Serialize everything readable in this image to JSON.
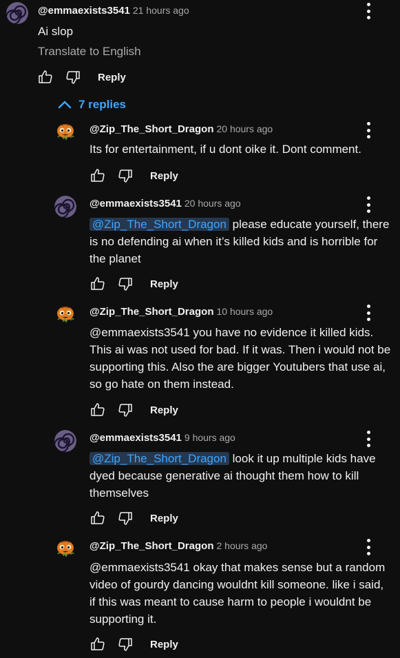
{
  "top_comment": {
    "handle": "@emmaexists3541",
    "time": "21 hours ago",
    "text": "Ai slop",
    "translate_label": "Translate to English",
    "reply_label": "Reply",
    "avatar_icon": "spiral-avatar-icon"
  },
  "replies_toggle": {
    "label": "7 replies",
    "icon": "chevron-up-icon"
  },
  "replies": [
    {
      "handle": "@Zip_The_Short_Dragon",
      "time": "20 hours ago",
      "mention": "",
      "text": "Its for entertainment, if u dont oike it. Dont comment.",
      "reply_label": "Reply",
      "avatar_icon": "pumpkin-avatar-icon"
    },
    {
      "handle": "@emmaexists3541",
      "time": "20 hours ago",
      "mention": "@Zip_The_Short_Dragon",
      "text": "please educate yourself, there is no defending ai when it’s killed kids and is horrible for the planet",
      "reply_label": "Reply",
      "avatar_icon": "spiral-avatar-icon"
    },
    {
      "handle": "@Zip_The_Short_Dragon",
      "time": "10 hours ago",
      "mention": "",
      "text": "@emmaexists3541 you have no evidence it killed kids. This ai was not used for bad. If it was. Then i would not be supporting this. Also the are bigger Youtubers that use ai, so go hate on them instead.",
      "reply_label": "Reply",
      "avatar_icon": "pumpkin-avatar-icon"
    },
    {
      "handle": "@emmaexists3541",
      "time": "9 hours ago",
      "mention": "@Zip_The_Short_Dragon",
      "text": "look it up multiple kids have dyed because generative ai thought them how to kill themselves",
      "reply_label": "Reply",
      "avatar_icon": "spiral-avatar-icon"
    },
    {
      "handle": "@Zip_The_Short_Dragon",
      "time": "2 hours ago",
      "mention": "",
      "text": "@emmaexists3541 okay that makes sense but a random video of gourdy dancing wouldnt kill someone. like i said, if this was meant to cause harm to people i wouldnt be supporting it.",
      "reply_label": "Reply",
      "avatar_icon": "pumpkin-avatar-icon"
    }
  ],
  "colors": {
    "background": "#0f0f0f",
    "text": "#f1f1f1",
    "secondary_text": "#aaaaaa",
    "link": "#3ea6ff",
    "mention_bg": "#263850"
  }
}
